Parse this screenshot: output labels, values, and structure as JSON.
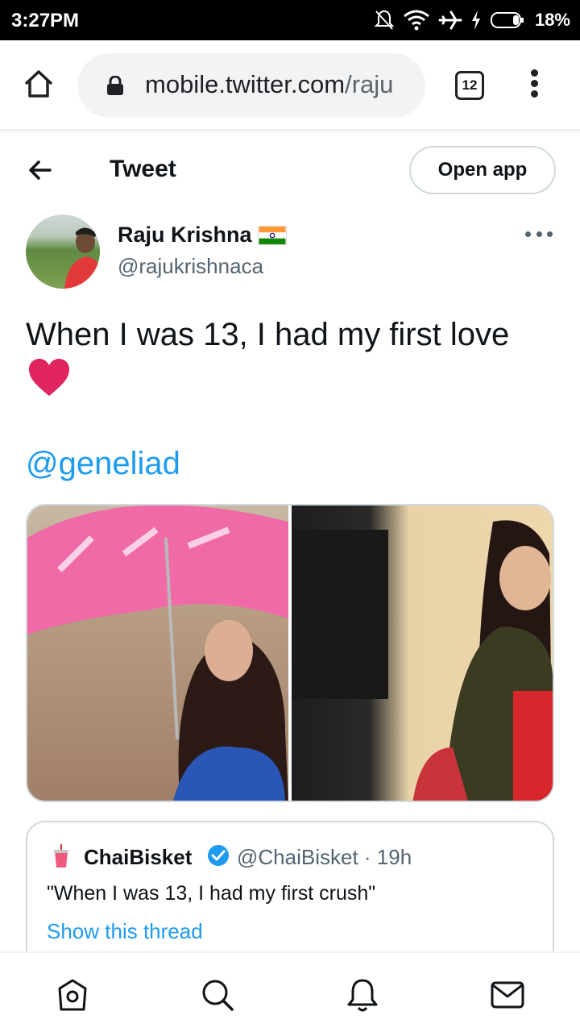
{
  "status_bar": {
    "time": "3:27PM",
    "battery": "18%",
    "icons": [
      "mute-icon",
      "wifi-icon",
      "airplane-icon",
      "charging-icon",
      "battery-icon"
    ]
  },
  "browser": {
    "url_host": "mobile.twitter.com",
    "url_path": "/raju",
    "tab_count": "12"
  },
  "header": {
    "title": "Tweet",
    "open_app": "Open app"
  },
  "tweet": {
    "author_name": "Raju Krishna",
    "author_handle": "@rajukrishnaca",
    "text": "When I was 13, I had my first love",
    "mention": "@geneliad"
  },
  "quoted_tweet": {
    "name": "ChaiBisket",
    "handle": "@ChaiBisket · 19h",
    "text": "\"When I was 13, I had my first crush\"",
    "show_thread": "Show this thread"
  },
  "nav": [
    "home-icon",
    "search-icon",
    "notifications-bell-icon",
    "messages-mail-icon"
  ],
  "colors": {
    "link": "#1d9bf0",
    "heart": "#e0245e",
    "text": "#0f1419",
    "secondary": "#536471"
  }
}
